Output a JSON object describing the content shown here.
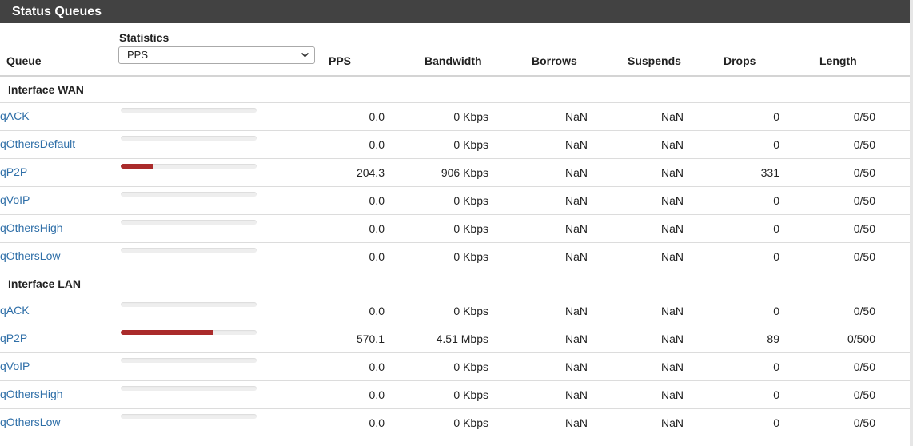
{
  "panel": {
    "title": "Status Queues"
  },
  "header": {
    "queue": "Queue",
    "statistics": "Statistics",
    "statistics_selected": "PPS",
    "pps": "PPS",
    "bandwidth": "Bandwidth",
    "borrows": "Borrows",
    "suspends": "Suspends",
    "drops": "Drops",
    "length": "Length"
  },
  "wan": {
    "label": "Interface WAN",
    "rows": [
      {
        "name": "qACK",
        "usage": 0,
        "pps": "0.0",
        "bandwidth": "0 Kbps",
        "borrows": "NaN",
        "suspends": "NaN",
        "drops": "0",
        "length": "0/50"
      },
      {
        "name": "qOthersDefault",
        "usage": 0,
        "pps": "0.0",
        "bandwidth": "0 Kbps",
        "borrows": "NaN",
        "suspends": "NaN",
        "drops": "0",
        "length": "0/50"
      },
      {
        "name": "qP2P",
        "usage": 0.24,
        "pps": "204.3",
        "bandwidth": "906 Kbps",
        "borrows": "NaN",
        "suspends": "NaN",
        "drops": "331",
        "length": "0/50"
      },
      {
        "name": "qVoIP",
        "usage": 0,
        "pps": "0.0",
        "bandwidth": "0 Kbps",
        "borrows": "NaN",
        "suspends": "NaN",
        "drops": "0",
        "length": "0/50"
      },
      {
        "name": "qOthersHigh",
        "usage": 0,
        "pps": "0.0",
        "bandwidth": "0 Kbps",
        "borrows": "NaN",
        "suspends": "NaN",
        "drops": "0",
        "length": "0/50"
      },
      {
        "name": "qOthersLow",
        "usage": 0,
        "pps": "0.0",
        "bandwidth": "0 Kbps",
        "borrows": "NaN",
        "suspends": "NaN",
        "drops": "0",
        "length": "0/50"
      }
    ]
  },
  "lan": {
    "label": "Interface LAN",
    "rows": [
      {
        "name": "qACK",
        "usage": 0,
        "pps": "0.0",
        "bandwidth": "0 Kbps",
        "borrows": "NaN",
        "suspends": "NaN",
        "drops": "0",
        "length": "0/50"
      },
      {
        "name": "qP2P",
        "usage": 0.68,
        "pps": "570.1",
        "bandwidth": "4.51 Mbps",
        "borrows": "NaN",
        "suspends": "NaN",
        "drops": "89",
        "length": "0/500"
      },
      {
        "name": "qVoIP",
        "usage": 0,
        "pps": "0.0",
        "bandwidth": "0 Kbps",
        "borrows": "NaN",
        "suspends": "NaN",
        "drops": "0",
        "length": "0/50"
      },
      {
        "name": "qOthersHigh",
        "usage": 0,
        "pps": "0.0",
        "bandwidth": "0 Kbps",
        "borrows": "NaN",
        "suspends": "NaN",
        "drops": "0",
        "length": "0/50"
      },
      {
        "name": "qOthersLow",
        "usage": 0,
        "pps": "0.0",
        "bandwidth": "0 Kbps",
        "borrows": "NaN",
        "suspends": "NaN",
        "drops": "0",
        "length": "0/50"
      }
    ]
  },
  "colors": {
    "titlebar": "#424242",
    "link": "#2f6fa8",
    "usage_bar": "#aa2b2b"
  }
}
